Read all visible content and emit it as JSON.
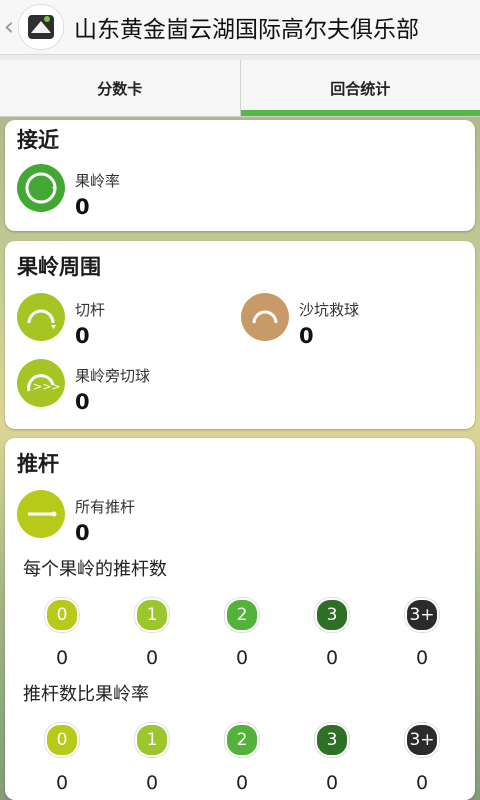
{
  "header": {
    "title": "山东黄金崮云湖国际高尔夫俱乐部"
  },
  "tabs": [
    {
      "label": "分数卡",
      "active": false
    },
    {
      "label": "回合统计",
      "active": true
    }
  ],
  "approach": {
    "title": "接近",
    "items": [
      {
        "label": "果岭率",
        "value": "0",
        "color": "#43a833"
      }
    ]
  },
  "around_green": {
    "title": "果岭周围",
    "items": [
      {
        "label": "切杆",
        "value": "0",
        "color": "#a6c525"
      },
      {
        "label": "沙坑救球",
        "value": "0",
        "color": "#c79a67"
      },
      {
        "label": "果岭旁切球",
        "value": "0",
        "color": "#a6c525"
      }
    ]
  },
  "putting": {
    "title": "推杆",
    "all_putts": {
      "label": "所有推杆",
      "value": "0",
      "color": "#b7c919"
    },
    "per_hole": {
      "title": "每个果岭的推杆数",
      "items": [
        {
          "label": "0",
          "value": "0",
          "color": "#b7c919"
        },
        {
          "label": "1",
          "value": "0",
          "color": "#9ac72b"
        },
        {
          "label": "2",
          "value": "0",
          "color": "#52b23c"
        },
        {
          "label": "3",
          "value": "0",
          "color": "#2d6f24"
        },
        {
          "label": "3+",
          "value": "0",
          "color": "#2b2b2b"
        }
      ]
    },
    "ratio": {
      "title": "推杆数比果岭率",
      "items": [
        {
          "label": "0",
          "value": "0",
          "color": "#b7c919"
        },
        {
          "label": "1",
          "value": "0",
          "color": "#9ac72b"
        },
        {
          "label": "2",
          "value": "0",
          "color": "#52b23c"
        },
        {
          "label": "3",
          "value": "0",
          "color": "#2d6f24"
        },
        {
          "label": "3+",
          "value": "0",
          "color": "#2b2b2b"
        }
      ]
    }
  }
}
